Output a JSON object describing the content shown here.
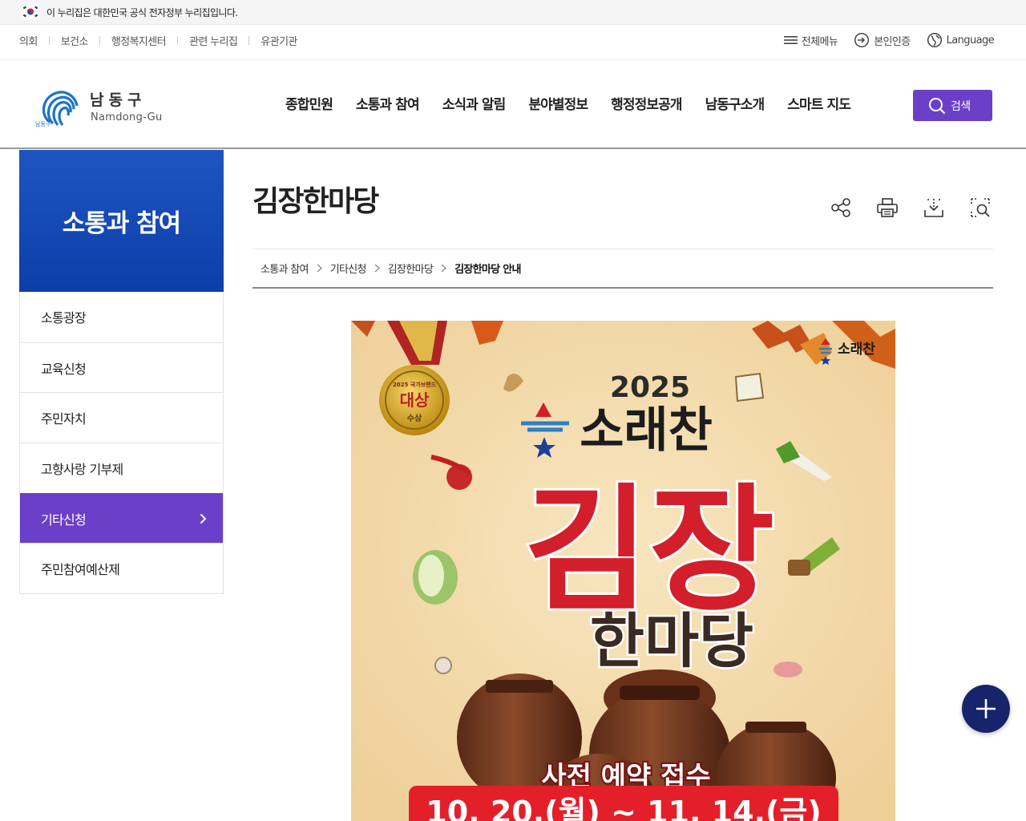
{
  "gov_banner": {
    "text": "이 누리집은 대한민국 공식 전자정부 누리집입니다."
  },
  "utility": {
    "left_links": [
      "의회",
      "보건소",
      "행정복지센터",
      "관련 누리집",
      "유관기관"
    ],
    "all_menu": "전체메뉴",
    "auth": "본인인증",
    "language": "Language"
  },
  "header": {
    "logo_ko": "남동구",
    "logo_en": "Namdong-Gu",
    "logo_badge": "남동구",
    "gnb": [
      "종합민원",
      "소통과 참여",
      "소식과 알림",
      "분야별정보",
      "행정정보공개",
      "남동구소개",
      "스마트 지도"
    ],
    "search_label": "검색"
  },
  "lnb": {
    "title": "소통과 참여",
    "items": [
      {
        "label": "소통광장"
      },
      {
        "label": "교육신청"
      },
      {
        "label": "주민자치"
      },
      {
        "label": "고향사랑 기부제"
      },
      {
        "label": "기타신청"
      },
      {
        "label": "주민참여예산제"
      }
    ],
    "active_index": 4
  },
  "content": {
    "page_title": "김장한마당",
    "breadcrumb": [
      "소통과 참여",
      "기타신청",
      "김장한마당",
      "김장한마당 안내"
    ]
  },
  "poster": {
    "year": "2025",
    "brand": "소래찬",
    "brand_small": "소래찬",
    "title_main": "김장",
    "title_sub": "한마당",
    "medal_award": "대상",
    "medal_sub": "수상",
    "medal_top": "2025 국가브랜드",
    "banner_text": "사전 예약 접수",
    "date_text": "10. 20.(월) ~ 11. 14.(금)"
  },
  "colors": {
    "accent_purple": "#6b3fc8",
    "lnb_blue": "#0d3ea8",
    "fab_navy": "#16256b",
    "poster_red": "#d21f2b"
  }
}
